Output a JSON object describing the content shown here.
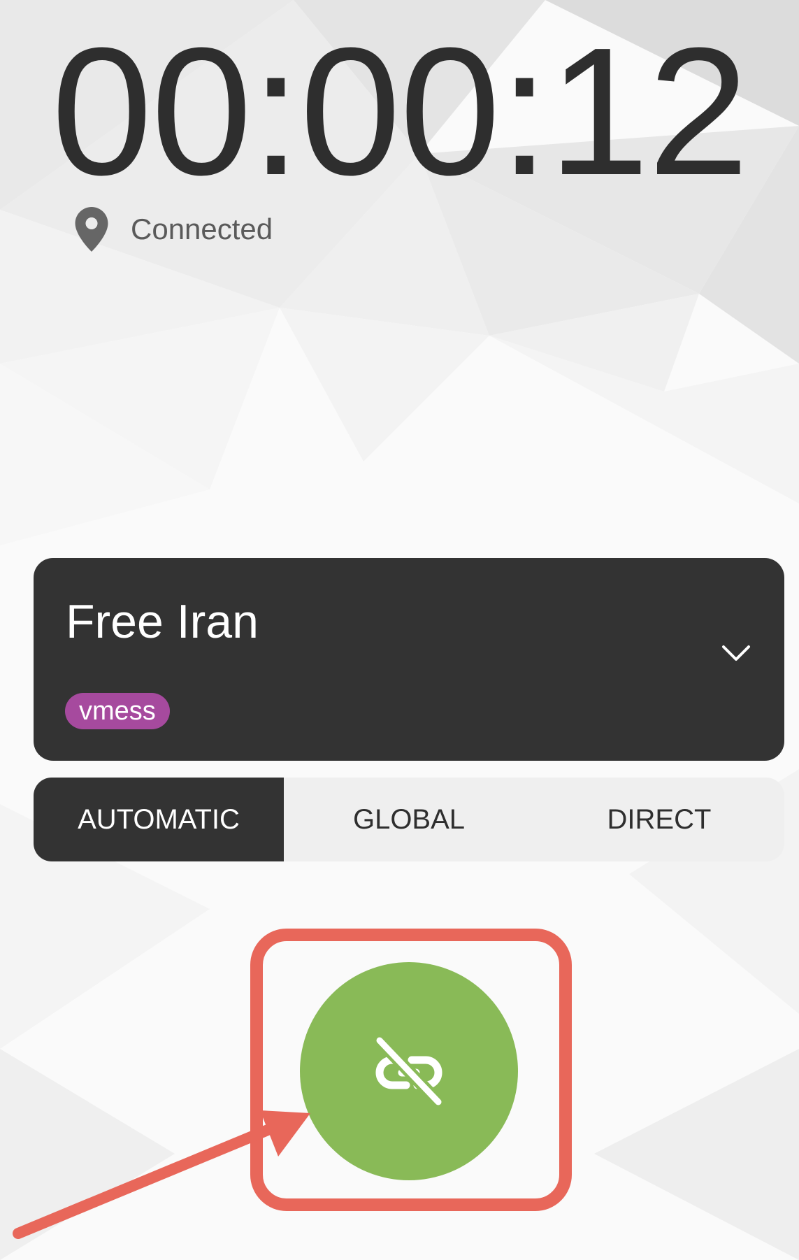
{
  "timer": {
    "elapsed": "00:00:12"
  },
  "status": {
    "icon": "location-pin-icon",
    "text": "Connected"
  },
  "server": {
    "name": "Free Iran",
    "protocol": "vmess",
    "expand_icon": "chevron-down-icon"
  },
  "mode": {
    "options": [
      "AUTOMATIC",
      "GLOBAL",
      "DIRECT"
    ],
    "selected": "AUTOMATIC"
  },
  "connect": {
    "icon": "link-off-icon",
    "state": "connected"
  },
  "colors": {
    "text_dark": "#2e2e2e",
    "card_bg": "#333333",
    "badge_bg": "#a64a9e",
    "button_green": "#89ba57",
    "annotation_red": "#e8675a",
    "toggle_bg": "#efefef"
  }
}
